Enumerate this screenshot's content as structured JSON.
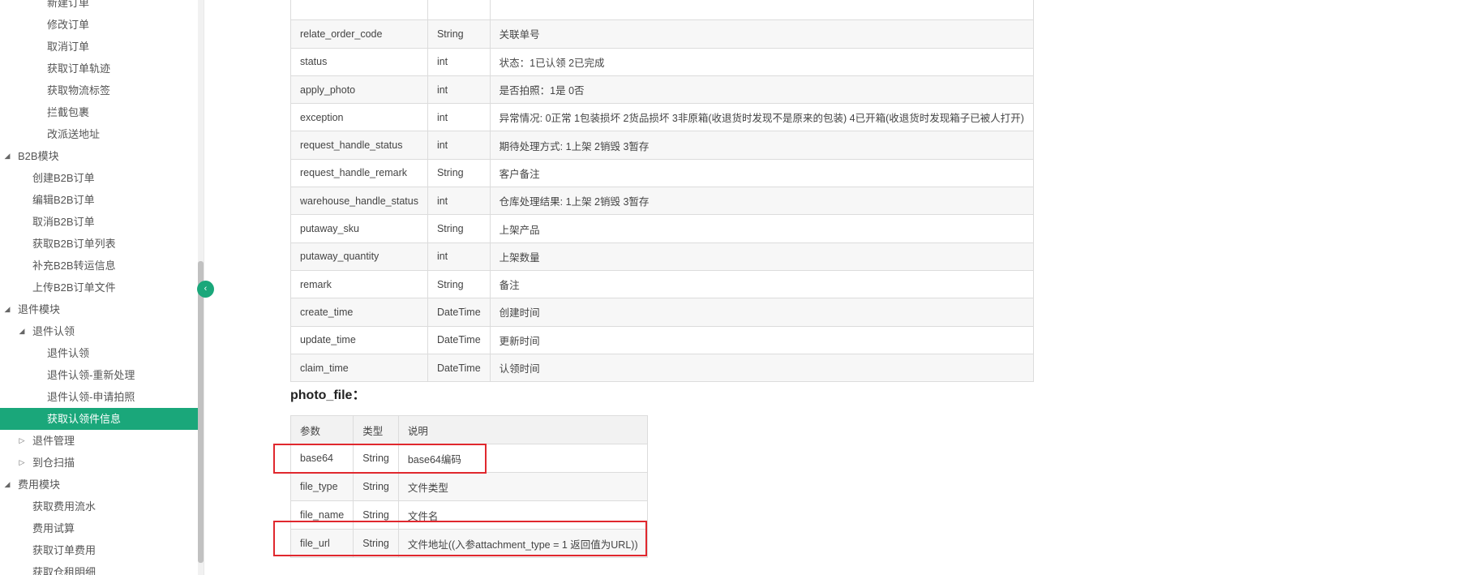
{
  "sidebar": {
    "items": [
      {
        "label": "新建订单",
        "level": 2,
        "arrow": ""
      },
      {
        "label": "修改订单",
        "level": 2,
        "arrow": ""
      },
      {
        "label": "取消订单",
        "level": 2,
        "arrow": ""
      },
      {
        "label": "获取订单轨迹",
        "level": 2,
        "arrow": ""
      },
      {
        "label": "获取物流标签",
        "level": 2,
        "arrow": ""
      },
      {
        "label": "拦截包裹",
        "level": 2,
        "arrow": ""
      },
      {
        "label": "改派送地址",
        "level": 2,
        "arrow": ""
      },
      {
        "label": "B2B模块",
        "level": 0,
        "arrow": "◢"
      },
      {
        "label": "创建B2B订单",
        "level": 1,
        "arrow": ""
      },
      {
        "label": "编辑B2B订单",
        "level": 1,
        "arrow": ""
      },
      {
        "label": "取消B2B订单",
        "level": 1,
        "arrow": ""
      },
      {
        "label": "获取B2B订单列表",
        "level": 1,
        "arrow": ""
      },
      {
        "label": "补充B2B转运信息",
        "level": 1,
        "arrow": ""
      },
      {
        "label": "上传B2B订单文件",
        "level": 1,
        "arrow": ""
      },
      {
        "label": "退件模块",
        "level": 0,
        "arrow": "◢"
      },
      {
        "label": "退件认领",
        "level": 1,
        "arrow": "◢"
      },
      {
        "label": "退件认领",
        "level": 2,
        "arrow": ""
      },
      {
        "label": "退件认领-重新处理",
        "level": 2,
        "arrow": ""
      },
      {
        "label": "退件认领-申请拍照",
        "level": 2,
        "arrow": ""
      },
      {
        "label": "获取认领件信息",
        "level": 2,
        "arrow": "",
        "active": true
      },
      {
        "label": "退件管理",
        "level": 1,
        "arrow": "▷"
      },
      {
        "label": "到仓扫描",
        "level": 1,
        "arrow": "▷"
      },
      {
        "label": "费用模块",
        "level": 0,
        "arrow": "◢"
      },
      {
        "label": "获取费用流水",
        "level": 1,
        "arrow": ""
      },
      {
        "label": "费用试算",
        "level": 1,
        "arrow": ""
      },
      {
        "label": "获取订单费用",
        "level": 1,
        "arrow": ""
      },
      {
        "label": "获取仓租明细",
        "level": 1,
        "arrow": ""
      }
    ],
    "collapse_icon": "‹"
  },
  "main_table": {
    "rows": [
      [
        "",
        "",
        ""
      ],
      [
        "relate_order_code",
        "String",
        "关联单号"
      ],
      [
        "status",
        "int",
        "状态：1已认领 2已完成"
      ],
      [
        "apply_photo",
        "int",
        "是否拍照：1是 0否"
      ],
      [
        "exception",
        "int",
        "异常情况: 0正常 1包装损坏 2货品损坏 3非原箱(收退货时发现不是原来的包装) 4已开箱(收退货时发现箱子已被人打开)"
      ],
      [
        "request_handle_status",
        "int",
        "期待处理方式: 1上架 2销毁 3暂存"
      ],
      [
        "request_handle_remark",
        "String",
        "客户备注"
      ],
      [
        "warehouse_handle_status",
        "int",
        "仓库处理结果: 1上架 2销毁 3暂存"
      ],
      [
        "putaway_sku",
        "String",
        "上架产品"
      ],
      [
        "putaway_quantity",
        "int",
        "上架数量"
      ],
      [
        "remark",
        "String",
        "备注"
      ],
      [
        "create_time",
        "DateTime",
        "创建时间"
      ],
      [
        "update_time",
        "DateTime",
        "更新时间"
      ],
      [
        "claim_time",
        "DateTime",
        "认领时间"
      ]
    ]
  },
  "photo_file": {
    "title": "photo_file：",
    "headers": [
      "参数",
      "类型",
      "说明"
    ],
    "rows": [
      [
        "base64",
        "String",
        "base64编码"
      ],
      [
        "file_type",
        "String",
        "文件类型"
      ],
      [
        "file_name",
        "String",
        "文件名"
      ],
      [
        "file_url",
        "String",
        "文件地址((入参attachment_type = 1 返回值为URL))"
      ]
    ]
  },
  "colors": {
    "accent": "#1aa77a",
    "highlight": "#e0282e"
  }
}
